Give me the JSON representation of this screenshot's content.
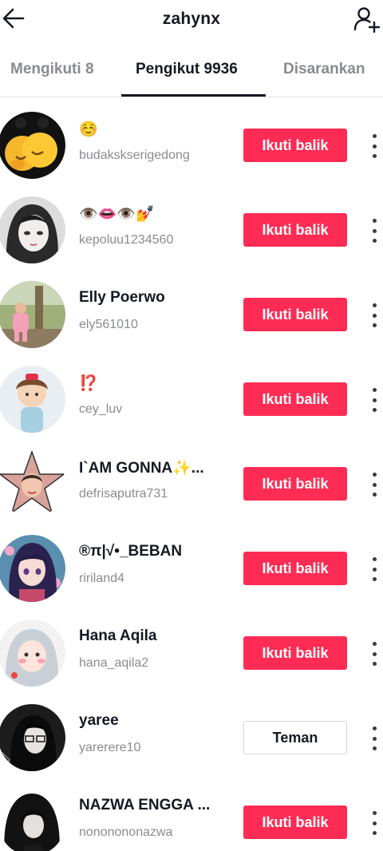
{
  "header": {
    "title": "zahynx",
    "back_icon": "arrow-left-icon",
    "add_icon": "add-user-icon"
  },
  "tabs": [
    {
      "label": "Mengikuti 8",
      "active": false
    },
    {
      "label": "Pengikut 9936",
      "active": true
    },
    {
      "label": "Disarankan",
      "active": false
    }
  ],
  "colors": {
    "follow_button": "#fe2c55",
    "text_primary": "#161823",
    "text_secondary": "#8a8b91"
  },
  "followers": [
    {
      "name": "☺️",
      "username": "budakskserigedong",
      "button": "Ikuti balik"
    },
    {
      "name": "👁️👄👁️💅",
      "username": "kepoluu1234560",
      "button": "Ikuti balik"
    },
    {
      "name": "Elly Poerwo",
      "username": "ely561010",
      "button": "Ikuti balik"
    },
    {
      "name": "⁉️",
      "username": "cey_luv",
      "button": "Ikuti balik"
    },
    {
      "name": "I`AM GONNA✨...",
      "username": "defrisaputra731",
      "button": "Ikuti balik"
    },
    {
      "name": "®π|√•_BEBAN",
      "username": "ririland4",
      "button": "Ikuti balik"
    },
    {
      "name": "Hana Aqila",
      "username": "hana_aqila2",
      "button": "Ikuti balik"
    },
    {
      "name": "yaree",
      "username": "yarerere10",
      "button": "Teman"
    },
    {
      "name": "NAZWA ENGGA ...",
      "username": "nononononazwa",
      "button": "Ikuti balik"
    }
  ]
}
